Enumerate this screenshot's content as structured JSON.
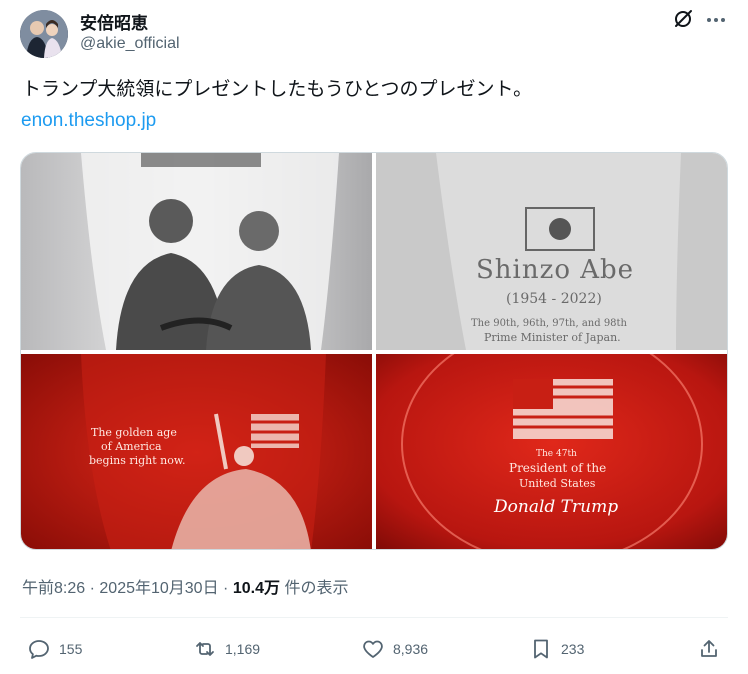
{
  "author": {
    "display_name": "安倍昭恵",
    "handle": "@akie_official"
  },
  "header_icons": [
    "grok-icon",
    "more-icon"
  ],
  "tweet": {
    "text": "トランプ大統領にプレゼントしたもうひとつのプレゼント。",
    "link": "enon.theshop.jp"
  },
  "media": {
    "photos": [
      {
        "kind": "engraved-glass-portrait"
      },
      {
        "kind": "engraved-glass-text",
        "name": "Shinzo Abe",
        "years": "(1954 - 2022)",
        "line1": "The 90th, 96th, 97th, and 98th",
        "line2": "Prime Minister of Japan."
      },
      {
        "kind": "engraved-glass-red",
        "line1": "The golden age",
        "line2": "of America",
        "line3": "begins right now."
      },
      {
        "kind": "engraved-glass-base",
        "line1": "The 47th",
        "line2": "President of the",
        "line3": "United States",
        "line4": "Donald Trump"
      }
    ]
  },
  "meta": {
    "time": "午前8:26",
    "date": "2025年10月30日",
    "separator": "·",
    "views_count": "10.4万",
    "views_label": "件の表示"
  },
  "actions": {
    "replies": "155",
    "reposts": "1,169",
    "likes": "8,936",
    "bookmarks": "233"
  },
  "colors": {
    "link": "#1d9bf0",
    "secondary_text": "#536471"
  }
}
